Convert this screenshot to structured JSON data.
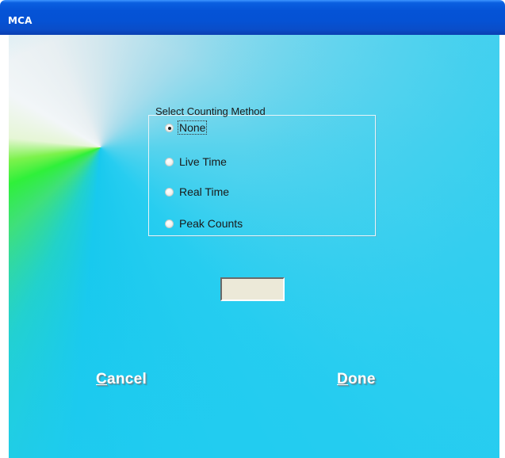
{
  "window": {
    "title": "MCA"
  },
  "counting_method": {
    "legend": "Select Counting Method",
    "options": [
      {
        "label": "None",
        "checked": true
      },
      {
        "label": "Live Time",
        "checked": false
      },
      {
        "label": "Real Time",
        "checked": false
      },
      {
        "label": "Peak Counts",
        "checked": false
      }
    ]
  },
  "value_field": {
    "value": ""
  },
  "buttons": {
    "cancel": {
      "mnemonic": "C",
      "rest": "ancel"
    },
    "done": {
      "mnemonic": "D",
      "rest": "one"
    }
  }
}
